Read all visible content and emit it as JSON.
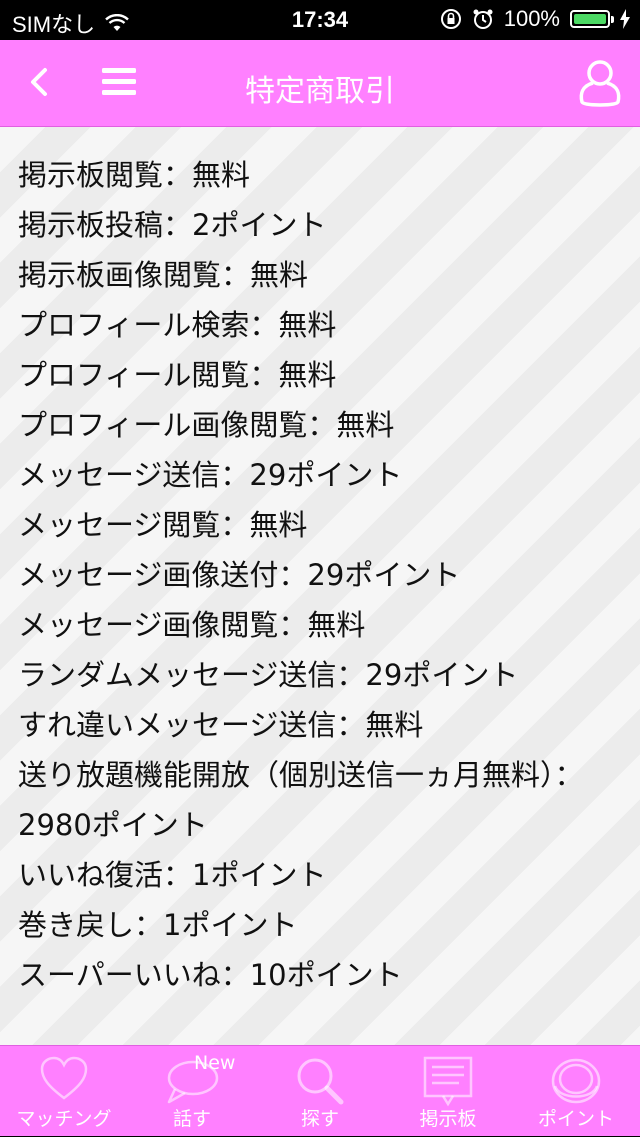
{
  "status_bar": {
    "carrier": "SIMなし",
    "time": "17:34",
    "battery": "100%",
    "battery_level": 1.0
  },
  "header": {
    "title": "特定商取引"
  },
  "pricing_items": [
    "掲示板閲覧：無料",
    "掲示板投稿：2ポイント",
    "掲示板画像閲覧：無料",
    "プロフィール検索：無料",
    "プロフィール閲覧：無料",
    "プロフィール画像閲覧：無料",
    "メッセージ送信：29ポイント",
    "メッセージ閲覧：無料",
    "メッセージ画像送付：29ポイント",
    "メッセージ画像閲覧：無料",
    "ランダムメッセージ送信：29ポイント",
    "すれ違いメッセージ送信：無料",
    "送り放題機能開放（個別送信一ヵ月無料）：2980ポイント",
    "いいね復活：1ポイント",
    "巻き戻し：1ポイント",
    "スーパーいいね：10ポイント"
  ],
  "tabs": [
    {
      "label": "マッチング",
      "icon": "heart-icon"
    },
    {
      "label": "話す",
      "icon": "speech-bubble-icon",
      "badge": "New"
    },
    {
      "label": "探す",
      "icon": "search-icon"
    },
    {
      "label": "掲示板",
      "icon": "bulletin-board-icon"
    },
    {
      "label": "ポイント",
      "icon": "coin-icon"
    }
  ],
  "colors": {
    "accent": "#ff80ff",
    "status_bar": "#000000",
    "battery_fill": "#4cd964"
  }
}
